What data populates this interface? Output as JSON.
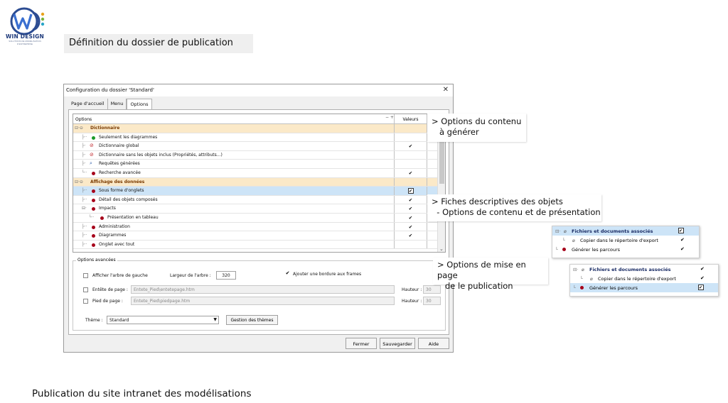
{
  "logo": {
    "text": "WIN DESIGN",
    "sub": "SOLUTIONS DE MODÉLISATION D'ENTREPRISE"
  },
  "page_title": "Définition du dossier de publication",
  "bottom_title": "Publication du site intranet des modélisations",
  "dialog": {
    "title": "Configuration du dossier 'Standard'",
    "close": "✕",
    "tabs": [
      "Page d'accueil",
      "Menu",
      "Options"
    ],
    "grid": {
      "col_options": "Options",
      "col_collapse": "− +",
      "col_values": "Valeurs",
      "rows": [
        {
          "label": "Dictionnaire",
          "value": ""
        },
        {
          "label": "Seulement les diagrammes",
          "value": ""
        },
        {
          "label": "Dictionnaire global",
          "value": "✔"
        },
        {
          "label": "Dictionnaire sans les objets inclus (Propriétés, attributs...)",
          "value": ""
        },
        {
          "label": "Requêtes générées",
          "value": ""
        },
        {
          "label": "Recherche avancée",
          "value": "✔"
        },
        {
          "label": "Affichage des données",
          "value": ""
        },
        {
          "label": "Sous forme d'onglets",
          "value": "✔"
        },
        {
          "label": "Détail des objets composés",
          "value": "✔"
        },
        {
          "label": "Impacts",
          "value": "✔"
        },
        {
          "label": "Présentation en tableau",
          "value": "✔"
        },
        {
          "label": "Administration",
          "value": "✔"
        },
        {
          "label": "Diagrammes",
          "value": "✔"
        },
        {
          "label": "Onglet avec tout",
          "value": ""
        }
      ]
    },
    "advanced": {
      "legend": "Options avancées",
      "show_tree": "Afficher l'arbre de gauche",
      "tree_width_label": "Largeur de l'arbre :",
      "tree_width_value": "320",
      "frame_border": "Ajouter une bordure aux frames",
      "header_label": "Entête de page :",
      "header_value": "Entete_Pied\\entetepage.htm",
      "header_height_label": "Hauteur :",
      "header_height_value": "30",
      "footer_label": "Pied de page :",
      "footer_value": "Entete_Pied\\piedpage.htm",
      "footer_height_label": "Hauteur :",
      "footer_height_value": "30",
      "theme_label": "Thème :",
      "theme_value": "Standard",
      "theme_button": "Gestion des thèmes"
    },
    "buttons": {
      "close": "Fermer",
      "save": "Sauvegarder",
      "help": "Aide"
    }
  },
  "callouts": {
    "c1_line1": "> Options du contenu",
    "c1_line2": "   à générer",
    "c2_line1": "> Fiches descriptives des objets",
    "c2_line2": "  - Options de contenu et de présentation",
    "c3_line1": "> Options de mise en page",
    "c3_line2": "   de le publication"
  },
  "mini1": {
    "row1": "Fichiers et documents associés",
    "row2": "Copier dans le répertoire d'export",
    "row2_val": "✔",
    "row3": "Générer les parcours",
    "row3_val": "✔"
  },
  "mini2": {
    "row1": "Fichiers et documents associés",
    "row1_val": "✔",
    "row2": "Copier dans le répertoire d'export",
    "row2_val": "✔",
    "row3": "Générer les parcours"
  },
  "colors": {
    "group_row": "#fbe9c8",
    "selected_row": "#cde4f7",
    "bullet_red": "#a6001a",
    "bullet_green": "#1b9a2a",
    "brand": "#1e3a7b"
  }
}
